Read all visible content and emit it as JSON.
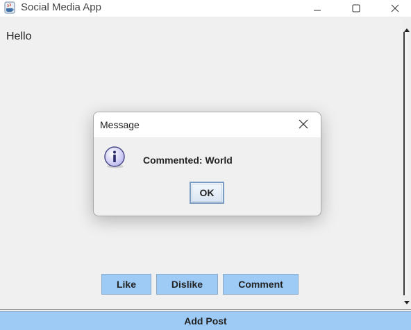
{
  "window": {
    "title": "Social Media App",
    "icon": "java-cup-icon"
  },
  "window_controls": {
    "minimize_icon": "minimize-icon",
    "maximize_icon": "maximize-icon",
    "close_icon": "close-icon"
  },
  "feed": {
    "post_text": "Hello"
  },
  "actions": {
    "like_label": "Like",
    "dislike_label": "Dislike",
    "comment_label": "Comment",
    "add_post_label": "Add Post"
  },
  "dialog": {
    "title": "Message",
    "message": "Commented: World",
    "ok_label": "OK",
    "icon": "info-icon",
    "close_icon": "close-icon"
  },
  "colors": {
    "button_fill": "#9ecbf5",
    "window_bg": "#f0f0f0",
    "titlebar_bg": "#ffffff"
  }
}
